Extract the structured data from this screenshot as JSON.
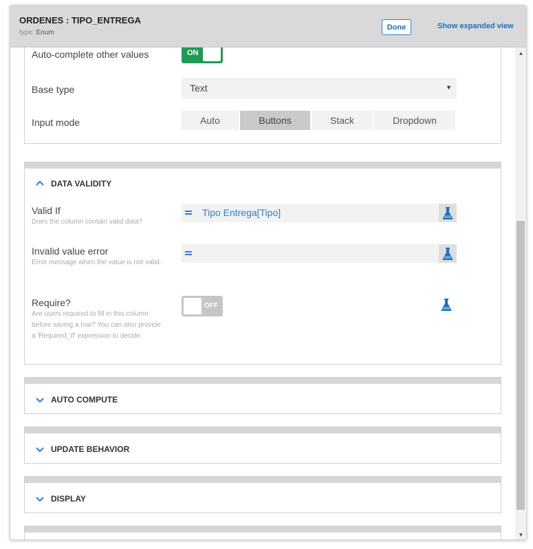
{
  "header": {
    "title": "ORDENES : TIPO_ENTREGA",
    "subtitle_label": "type:",
    "subtitle_value": "Enum",
    "done_label": "Done",
    "expand_label": "Show expanded view"
  },
  "settings": {
    "autocomplete_label": "Auto-complete other values",
    "autocomplete_toggle": "ON",
    "base_type_label": "Base type",
    "base_type_value": "Text",
    "input_mode_label": "Input mode",
    "input_modes": [
      "Auto",
      "Buttons",
      "Stack",
      "Dropdown"
    ],
    "input_mode_selected": "Buttons"
  },
  "data_validity": {
    "title": "DATA VALIDITY",
    "valid_if_label": "Valid If",
    "valid_if_help": "Does the column contain valid data?",
    "valid_if_value": "Tipo Entrega[Tipo]",
    "invalid_error_label": "Invalid value error",
    "invalid_error_help": "Error message when the value is not valid.",
    "invalid_error_value": "",
    "require_label": "Require?",
    "require_help": "Are users required to fill in this column before saving a row? You can also provide a 'Required_If' expression to decide.",
    "require_toggle": "OFF"
  },
  "sections": {
    "auto_compute": "AUTO COMPUTE",
    "update_behavior": "UPDATE BEHAVIOR",
    "display": "DISPLAY"
  },
  "colors": {
    "accent": "#2a7fd4",
    "toggle_on": "#1e9b53",
    "toggle_off": "#c6c6c6"
  }
}
